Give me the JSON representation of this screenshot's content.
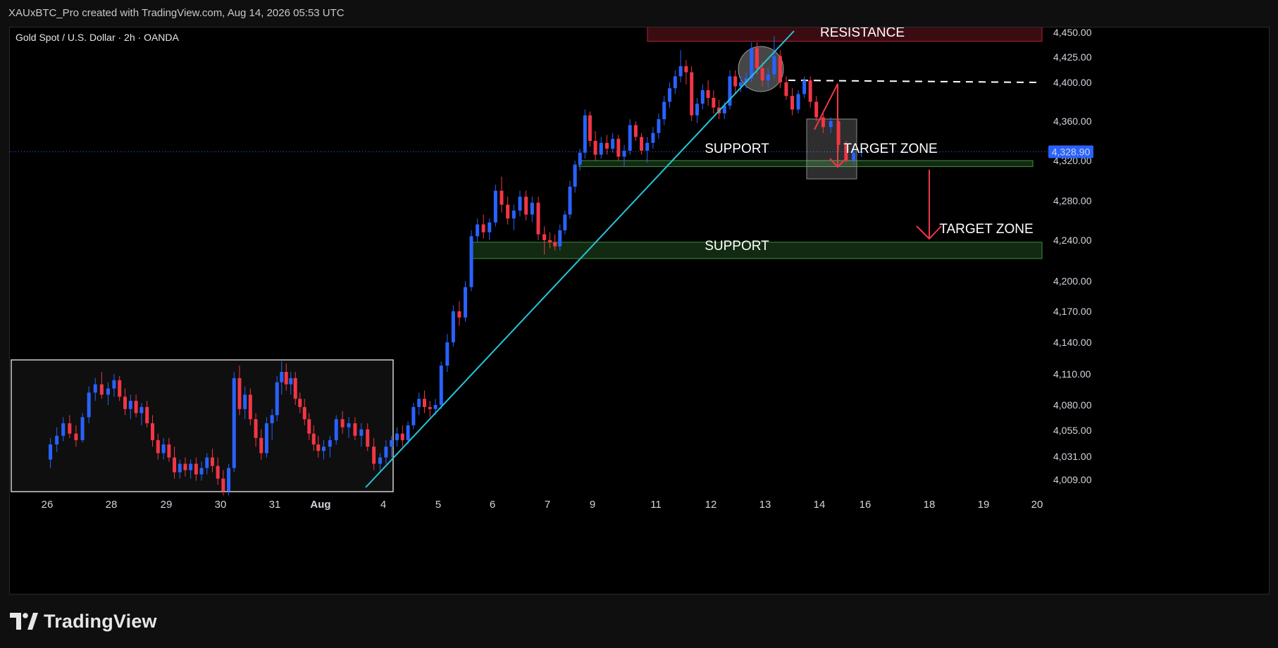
{
  "caption": "XAUxBTC_Pro created with TradingView.com, Aug 14, 2026 05:53 UTC",
  "symbol_title": "Gold Spot / U.S. Dollar · 2h · OANDA",
  "brand": "TradingView",
  "colors": {
    "bg": "#000000",
    "up": "#2962ff",
    "down": "#f23645",
    "trendline": "#26c6da",
    "resistance_fill": "#3a0c12",
    "resistance_border": "#b22234",
    "support_fill": "#112a11",
    "support_border": "#3f8f3f",
    "price_label": "#2962ff",
    "arrow": "#f23645"
  },
  "annotations": {
    "resistance": "RESISTANCE",
    "support_upper": "SUPPORT",
    "support_lower": "SUPPORT",
    "target_zone_1": "TARGET ZONE",
    "target_zone_2": "TARGET ZONE"
  },
  "chart_data": {
    "type": "candlestick",
    "title": "Gold Spot / U.S. Dollar · 2h · OANDA",
    "x_ticks": [
      "26",
      "28",
      "29",
      "30",
      "31",
      "Aug",
      "4",
      "5",
      "6",
      "7",
      "9",
      "11",
      "12",
      "13",
      "14",
      "16",
      "18",
      "19",
      "20"
    ],
    "y_ticks": [
      "4,450.00",
      "4,425.00",
      "4,400.00",
      "4,360.00",
      "4,320.00",
      "4,280.00",
      "4,240.00",
      "4,200.00",
      "4,170.00",
      "4,140.00",
      "4,110.00",
      "4,080.00",
      "4,055.00",
      "4,031.00",
      "4,009.00"
    ],
    "last_price": "4,328.90",
    "resistance_zone": [
      4441,
      4456
    ],
    "support_zones": [
      [
        4314,
        4320
      ],
      [
        4222,
        4238
      ]
    ],
    "dashed_level": 4400,
    "grid": false,
    "ohlc": [
      {
        "x": "26",
        "o": 4028,
        "h": 4048,
        "l": 4020,
        "c": 4042
      },
      {
        "x": "26",
        "o": 4042,
        "h": 4058,
        "l": 4035,
        "c": 4050
      },
      {
        "x": "26",
        "o": 4050,
        "h": 4068,
        "l": 4045,
        "c": 4062
      },
      {
        "x": "26",
        "o": 4062,
        "h": 4070,
        "l": 4048,
        "c": 4052
      },
      {
        "x": "26",
        "o": 4052,
        "h": 4060,
        "l": 4040,
        "c": 4046
      },
      {
        "x": "26",
        "o": 4046,
        "h": 4072,
        "l": 4044,
        "c": 4068
      },
      {
        "x": "26",
        "o": 4068,
        "h": 4098,
        "l": 4062,
        "c": 4092
      },
      {
        "x": "26",
        "o": 4092,
        "h": 4106,
        "l": 4084,
        "c": 4100
      },
      {
        "x": "26",
        "o": 4100,
        "h": 4112,
        "l": 4086,
        "c": 4090
      },
      {
        "x": "26",
        "o": 4090,
        "h": 4102,
        "l": 4080,
        "c": 4096
      },
      {
        "x": "28",
        "o": 4096,
        "h": 4110,
        "l": 4088,
        "c": 4104
      },
      {
        "x": "28",
        "o": 4104,
        "h": 4108,
        "l": 4084,
        "c": 4088
      },
      {
        "x": "28",
        "o": 4088,
        "h": 4096,
        "l": 4070,
        "c": 4076
      },
      {
        "x": "28",
        "o": 4076,
        "h": 4090,
        "l": 4066,
        "c": 4084
      },
      {
        "x": "28",
        "o": 4084,
        "h": 4090,
        "l": 4068,
        "c": 4072
      },
      {
        "x": "28",
        "o": 4072,
        "h": 4082,
        "l": 4060,
        "c": 4078
      },
      {
        "x": "28",
        "o": 4078,
        "h": 4084,
        "l": 4058,
        "c": 4062
      },
      {
        "x": "28",
        "o": 4062,
        "h": 4070,
        "l": 4040,
        "c": 4046
      },
      {
        "x": "28",
        "o": 4046,
        "h": 4052,
        "l": 4028,
        "c": 4034
      },
      {
        "x": "28",
        "o": 4034,
        "h": 4048,
        "l": 4028,
        "c": 4042
      },
      {
        "x": "29",
        "o": 4042,
        "h": 4048,
        "l": 4026,
        "c": 4030
      },
      {
        "x": "29",
        "o": 4030,
        "h": 4040,
        "l": 4010,
        "c": 4016
      },
      {
        "x": "29",
        "o": 4016,
        "h": 4028,
        "l": 4010,
        "c": 4024
      },
      {
        "x": "29",
        "o": 4024,
        "h": 4030,
        "l": 4012,
        "c": 4018
      },
      {
        "x": "29",
        "o": 4018,
        "h": 4028,
        "l": 4010,
        "c": 4024
      },
      {
        "x": "29",
        "o": 4024,
        "h": 4030,
        "l": 4008,
        "c": 4014
      },
      {
        "x": "29",
        "o": 4014,
        "h": 4026,
        "l": 4008,
        "c": 4020
      },
      {
        "x": "29",
        "o": 4020,
        "h": 4034,
        "l": 4014,
        "c": 4030
      },
      {
        "x": "29",
        "o": 4030,
        "h": 4038,
        "l": 4016,
        "c": 4022
      },
      {
        "x": "29",
        "o": 4022,
        "h": 4030,
        "l": 4004,
        "c": 4010
      },
      {
        "x": "30",
        "o": 4010,
        "h": 4018,
        "l": 3994,
        "c": 3998
      },
      {
        "x": "30",
        "o": 3998,
        "h": 4024,
        "l": 3994,
        "c": 4020
      },
      {
        "x": "30",
        "o": 4020,
        "h": 4112,
        "l": 4016,
        "c": 4106
      },
      {
        "x": "30",
        "o": 4106,
        "h": 4118,
        "l": 4070,
        "c": 4076
      },
      {
        "x": "30",
        "o": 4076,
        "h": 4098,
        "l": 4066,
        "c": 4090
      },
      {
        "x": "30",
        "o": 4090,
        "h": 4096,
        "l": 4060,
        "c": 4066
      },
      {
        "x": "30",
        "o": 4066,
        "h": 4072,
        "l": 4040,
        "c": 4048
      },
      {
        "x": "30",
        "o": 4048,
        "h": 4056,
        "l": 4028,
        "c": 4034
      },
      {
        "x": "30",
        "o": 4034,
        "h": 4068,
        "l": 4030,
        "c": 4062
      },
      {
        "x": "30",
        "o": 4062,
        "h": 4076,
        "l": 4046,
        "c": 4070
      },
      {
        "x": "31",
        "o": 4070,
        "h": 4108,
        "l": 4064,
        "c": 4102
      },
      {
        "x": "31",
        "o": 4102,
        "h": 4122,
        "l": 4090,
        "c": 4112
      },
      {
        "x": "31",
        "o": 4112,
        "h": 4120,
        "l": 4094,
        "c": 4100
      },
      {
        "x": "31",
        "o": 4100,
        "h": 4112,
        "l": 4090,
        "c": 4106
      },
      {
        "x": "31",
        "o": 4106,
        "h": 4112,
        "l": 4080,
        "c": 4086
      },
      {
        "x": "31",
        "o": 4086,
        "h": 4092,
        "l": 4072,
        "c": 4078
      },
      {
        "x": "31",
        "o": 4078,
        "h": 4086,
        "l": 4060,
        "c": 4066
      },
      {
        "x": "31",
        "o": 4066,
        "h": 4072,
        "l": 4046,
        "c": 4052
      },
      {
        "x": "31",
        "o": 4052,
        "h": 4060,
        "l": 4036,
        "c": 4042
      },
      {
        "x": "31",
        "o": 4042,
        "h": 4050,
        "l": 4030,
        "c": 4036
      },
      {
        "x": "Aug",
        "o": 4036,
        "h": 4046,
        "l": 4028,
        "c": 4040
      },
      {
        "x": "Aug",
        "o": 4040,
        "h": 4050,
        "l": 4030,
        "c": 4046
      },
      {
        "x": "Aug",
        "o": 4046,
        "h": 4070,
        "l": 4042,
        "c": 4066
      },
      {
        "x": "Aug",
        "o": 4066,
        "h": 4074,
        "l": 4052,
        "c": 4058
      },
      {
        "x": "Aug",
        "o": 4058,
        "h": 4068,
        "l": 4048,
        "c": 4062
      },
      {
        "x": "Aug",
        "o": 4062,
        "h": 4068,
        "l": 4046,
        "c": 4050
      },
      {
        "x": "Aug",
        "o": 4050,
        "h": 4062,
        "l": 4040,
        "c": 4056
      },
      {
        "x": "Aug",
        "o": 4056,
        "h": 4062,
        "l": 4036,
        "c": 4040
      },
      {
        "x": "Aug",
        "o": 4040,
        "h": 4048,
        "l": 4018,
        "c": 4024
      },
      {
        "x": "Aug",
        "o": 4024,
        "h": 4034,
        "l": 4016,
        "c": 4030
      },
      {
        "x": "4",
        "o": 4030,
        "h": 4046,
        "l": 4024,
        "c": 4040
      },
      {
        "x": "4",
        "o": 4040,
        "h": 4050,
        "l": 4030,
        "c": 4046
      },
      {
        "x": "4",
        "o": 4046,
        "h": 4058,
        "l": 4040,
        "c": 4052
      },
      {
        "x": "4",
        "o": 4052,
        "h": 4060,
        "l": 4040,
        "c": 4046
      },
      {
        "x": "4",
        "o": 4046,
        "h": 4064,
        "l": 4042,
        "c": 4060
      },
      {
        "x": "4",
        "o": 4060,
        "h": 4082,
        "l": 4056,
        "c": 4078
      },
      {
        "x": "4",
        "o": 4078,
        "h": 4092,
        "l": 4070,
        "c": 4086
      },
      {
        "x": "4",
        "o": 4086,
        "h": 4094,
        "l": 4072,
        "c": 4078
      },
      {
        "x": "4",
        "o": 4078,
        "h": 4084,
        "l": 4068,
        "c": 4076
      },
      {
        "x": "4",
        "o": 4076,
        "h": 4086,
        "l": 4070,
        "c": 4080
      },
      {
        "x": "5",
        "o": 4080,
        "h": 4122,
        "l": 4076,
        "c": 4118
      },
      {
        "x": "5",
        "o": 4118,
        "h": 4148,
        "l": 4112,
        "c": 4140
      },
      {
        "x": "5",
        "o": 4140,
        "h": 4176,
        "l": 4136,
        "c": 4170
      },
      {
        "x": "5",
        "o": 4170,
        "h": 4180,
        "l": 4156,
        "c": 4164
      },
      {
        "x": "5",
        "o": 4164,
        "h": 4200,
        "l": 4160,
        "c": 4194
      },
      {
        "x": "5",
        "o": 4194,
        "h": 4250,
        "l": 4190,
        "c": 4244
      },
      {
        "x": "5",
        "o": 4244,
        "h": 4262,
        "l": 4238,
        "c": 4256
      },
      {
        "x": "5",
        "o": 4256,
        "h": 4266,
        "l": 4242,
        "c": 4248
      },
      {
        "x": "5",
        "o": 4248,
        "h": 4262,
        "l": 4240,
        "c": 4258
      },
      {
        "x": "6",
        "o": 4258,
        "h": 4296,
        "l": 4254,
        "c": 4290
      },
      {
        "x": "6",
        "o": 4290,
        "h": 4304,
        "l": 4268,
        "c": 4276
      },
      {
        "x": "6",
        "o": 4276,
        "h": 4284,
        "l": 4256,
        "c": 4262
      },
      {
        "x": "6",
        "o": 4262,
        "h": 4276,
        "l": 4250,
        "c": 4270
      },
      {
        "x": "6",
        "o": 4270,
        "h": 4290,
        "l": 4264,
        "c": 4284
      },
      {
        "x": "6",
        "o": 4284,
        "h": 4290,
        "l": 4260,
        "c": 4266
      },
      {
        "x": "6",
        "o": 4266,
        "h": 4284,
        "l": 4258,
        "c": 4278
      },
      {
        "x": "6",
        "o": 4278,
        "h": 4284,
        "l": 4240,
        "c": 4246
      },
      {
        "x": "6",
        "o": 4246,
        "h": 4254,
        "l": 4226,
        "c": 4240
      },
      {
        "x": "7",
        "o": 4240,
        "h": 4248,
        "l": 4232,
        "c": 4238
      },
      {
        "x": "7",
        "o": 4238,
        "h": 4246,
        "l": 4230,
        "c": 4234
      },
      {
        "x": "7",
        "o": 4234,
        "h": 4256,
        "l": 4230,
        "c": 4250
      },
      {
        "x": "7",
        "o": 4250,
        "h": 4270,
        "l": 4246,
        "c": 4266
      },
      {
        "x": "7",
        "o": 4266,
        "h": 4300,
        "l": 4262,
        "c": 4294
      },
      {
        "x": "7",
        "o": 4294,
        "h": 4320,
        "l": 4288,
        "c": 4316
      },
      {
        "x": "7",
        "o": 4316,
        "h": 4332,
        "l": 4310,
        "c": 4328
      },
      {
        "x": "7",
        "o": 4328,
        "h": 4372,
        "l": 4322,
        "c": 4366
      },
      {
        "x": "7",
        "o": 4366,
        "h": 4370,
        "l": 4334,
        "c": 4340
      },
      {
        "x": "9",
        "o": 4340,
        "h": 4350,
        "l": 4320,
        "c": 4326
      },
      {
        "x": "9",
        "o": 4326,
        "h": 4344,
        "l": 4322,
        "c": 4338
      },
      {
        "x": "9",
        "o": 4338,
        "h": 4346,
        "l": 4326,
        "c": 4332
      },
      {
        "x": "9",
        "o": 4332,
        "h": 4348,
        "l": 4328,
        "c": 4342
      },
      {
        "x": "9",
        "o": 4342,
        "h": 4346,
        "l": 4320,
        "c": 4324
      },
      {
        "x": "9",
        "o": 4324,
        "h": 4336,
        "l": 4314,
        "c": 4330
      },
      {
        "x": "9",
        "o": 4330,
        "h": 4362,
        "l": 4326,
        "c": 4356
      },
      {
        "x": "9",
        "o": 4356,
        "h": 4360,
        "l": 4340,
        "c": 4344
      },
      {
        "x": "9",
        "o": 4344,
        "h": 4348,
        "l": 4326,
        "c": 4330
      },
      {
        "x": "9",
        "o": 4330,
        "h": 4344,
        "l": 4318,
        "c": 4338
      },
      {
        "x": "9",
        "o": 4338,
        "h": 4354,
        "l": 4332,
        "c": 4348
      },
      {
        "x": "11",
        "o": 4348,
        "h": 4368,
        "l": 4342,
        "c": 4362
      },
      {
        "x": "11",
        "o": 4362,
        "h": 4386,
        "l": 4356,
        "c": 4380
      },
      {
        "x": "11",
        "o": 4380,
        "h": 4400,
        "l": 4374,
        "c": 4394
      },
      {
        "x": "11",
        "o": 4394,
        "h": 4412,
        "l": 4388,
        "c": 4406
      },
      {
        "x": "11",
        "o": 4406,
        "h": 4432,
        "l": 4400,
        "c": 4416
      },
      {
        "x": "11",
        "o": 4416,
        "h": 4422,
        "l": 4398,
        "c": 4410
      },
      {
        "x": "11",
        "o": 4410,
        "h": 4416,
        "l": 4360,
        "c": 4366
      },
      {
        "x": "11",
        "o": 4366,
        "h": 4384,
        "l": 4358,
        "c": 4378
      },
      {
        "x": "11",
        "o": 4378,
        "h": 4398,
        "l": 4372,
        "c": 4392
      },
      {
        "x": "11",
        "o": 4392,
        "h": 4402,
        "l": 4376,
        "c": 4384
      },
      {
        "x": "12",
        "o": 4384,
        "h": 4392,
        "l": 4368,
        "c": 4374
      },
      {
        "x": "12",
        "o": 4374,
        "h": 4382,
        "l": 4362,
        "c": 4368
      },
      {
        "x": "12",
        "o": 4368,
        "h": 4380,
        "l": 4362,
        "c": 4376
      },
      {
        "x": "12",
        "o": 4376,
        "h": 4412,
        "l": 4372,
        "c": 4406
      },
      {
        "x": "12",
        "o": 4406,
        "h": 4412,
        "l": 4388,
        "c": 4396
      },
      {
        "x": "12",
        "o": 4396,
        "h": 4406,
        "l": 4390,
        "c": 4400
      },
      {
        "x": "12",
        "o": 4400,
        "h": 4410,
        "l": 4394,
        "c": 4404
      },
      {
        "x": "12",
        "o": 4404,
        "h": 4440,
        "l": 4400,
        "c": 4434
      },
      {
        "x": "12",
        "o": 4434,
        "h": 4440,
        "l": 4408,
        "c": 4414
      },
      {
        "x": "12",
        "o": 4414,
        "h": 4420,
        "l": 4396,
        "c": 4402
      },
      {
        "x": "13",
        "o": 4402,
        "h": 4414,
        "l": 4394,
        "c": 4408
      },
      {
        "x": "13",
        "o": 4408,
        "h": 4446,
        "l": 4404,
        "c": 4426
      },
      {
        "x": "13",
        "o": 4426,
        "h": 4432,
        "l": 4394,
        "c": 4400
      },
      {
        "x": "13",
        "o": 4400,
        "h": 4406,
        "l": 4382,
        "c": 4386
      },
      {
        "x": "13",
        "o": 4386,
        "h": 4394,
        "l": 4366,
        "c": 4372
      },
      {
        "x": "13",
        "o": 4372,
        "h": 4392,
        "l": 4368,
        "c": 4388
      },
      {
        "x": "13",
        "o": 4388,
        "h": 4406,
        "l": 4384,
        "c": 4402
      },
      {
        "x": "13",
        "o": 4402,
        "h": 4406,
        "l": 4374,
        "c": 4380
      },
      {
        "x": "13",
        "o": 4380,
        "h": 4386,
        "l": 4360,
        "c": 4364
      },
      {
        "x": "14",
        "o": 4364,
        "h": 4368,
        "l": 4348,
        "c": 4354
      },
      {
        "x": "14",
        "o": 4354,
        "h": 4364,
        "l": 4348,
        "c": 4360
      },
      {
        "x": "14",
        "o": 4360,
        "h": 4362,
        "l": 4330,
        "c": 4336
      },
      {
        "x": "14",
        "o": 4336,
        "h": 4340,
        "l": 4318,
        "c": 4320
      },
      {
        "x": "14",
        "o": 4320,
        "h": 4332,
        "l": 4316,
        "c": 4328
      },
      {
        "x": "14",
        "o": 4328,
        "h": 4334,
        "l": 4324,
        "c": 4329
      }
    ]
  }
}
